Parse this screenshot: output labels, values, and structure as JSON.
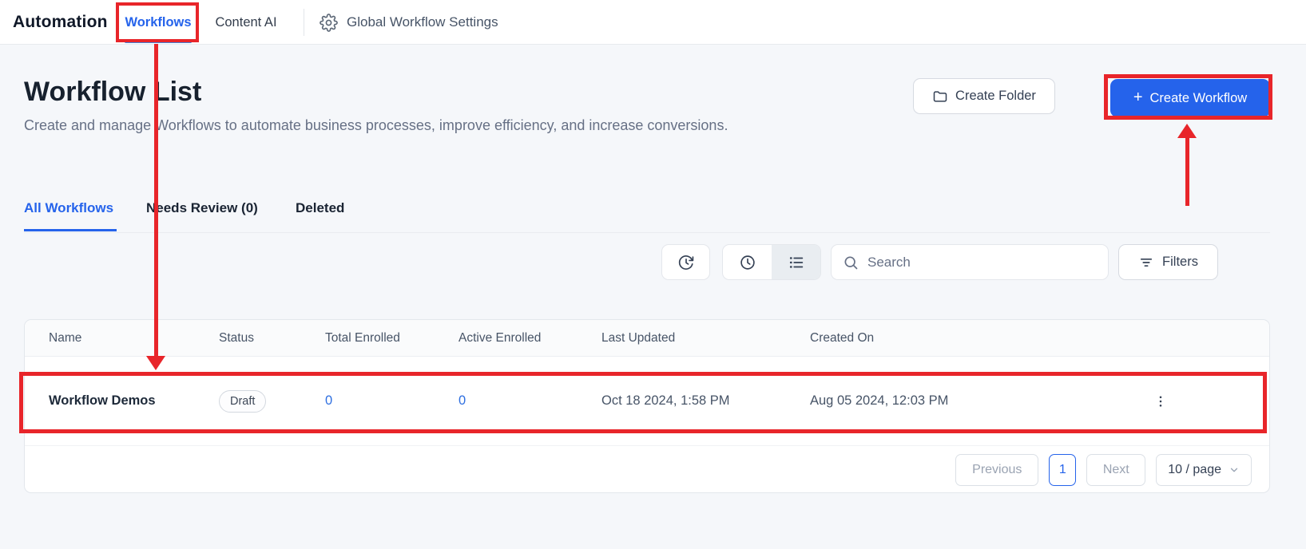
{
  "topbar": {
    "app_title": "Automation",
    "workflows_tab": "Workflows",
    "content_ai_tab": "Content AI",
    "settings_label": "Global Workflow Settings"
  },
  "header": {
    "title": "Workflow List",
    "description": "Create and manage Workflows to automate business processes, improve efficiency, and increase conversions.",
    "create_folder_label": "Create Folder",
    "create_workflow_plus": "+",
    "create_workflow_label": "Create Workflow"
  },
  "view_tabs": {
    "all": "All Workflows",
    "needs_review": "Needs Review (0)",
    "deleted": "Deleted"
  },
  "toolbar": {
    "search_placeholder": "Search",
    "filters_label": "Filters"
  },
  "table": {
    "columns": [
      "Name",
      "Status",
      "Total Enrolled",
      "Active Enrolled",
      "Last Updated",
      "Created On"
    ],
    "rows": [
      {
        "name": "Workflow Demos",
        "status": "Draft",
        "total_enrolled": "0",
        "active_enrolled": "0",
        "last_updated": "Oct 18 2024, 1:58 PM",
        "created_on": "Aug 05 2024, 12:03 PM"
      }
    ]
  },
  "pagination": {
    "previous_label": "Previous",
    "current_page": "1",
    "next_label": "Next",
    "page_size": "10 / page"
  },
  "colors": {
    "primary_blue": "#2563eb",
    "link_blue": "#2e6fe0",
    "annotation_red": "#e8252a",
    "page_background": "#f5f7fa"
  },
  "icons": [
    "gear-icon",
    "folder-icon",
    "plus-icon",
    "history-icon",
    "clock-icon",
    "list-view-icon",
    "search-icon",
    "filter-icon",
    "kebab-menu-icon",
    "chevron-down-icon"
  ]
}
